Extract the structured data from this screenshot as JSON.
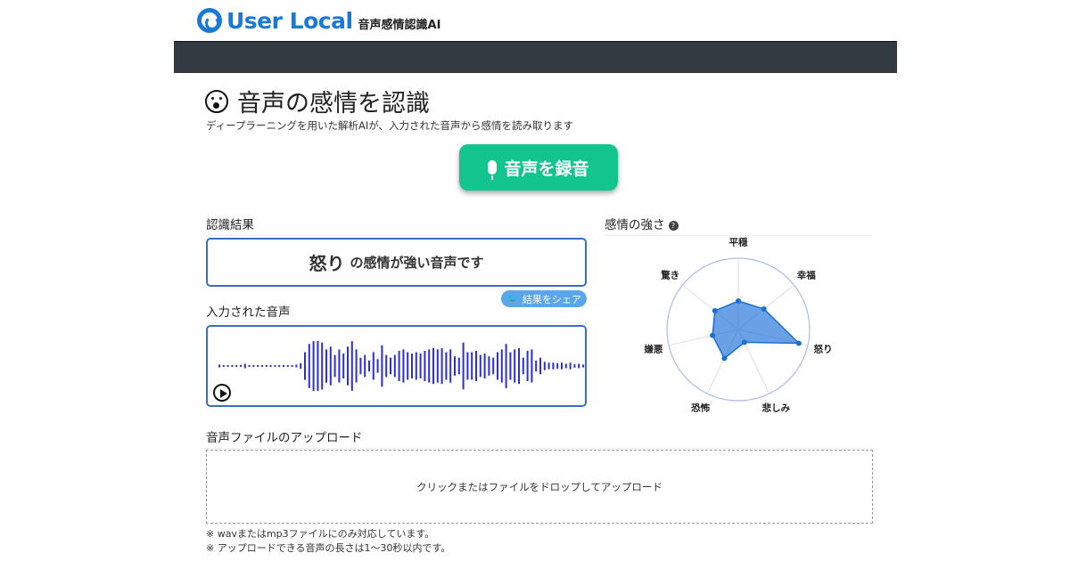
{
  "header": {
    "logo": "User Local",
    "product": "音声感情認識AI"
  },
  "page": {
    "title": "音声の感情を認識",
    "subtitle": "ディープラーニングを用いた解析AIが、入力された音声から感情を読み取ります",
    "record_button": "音声を録音"
  },
  "result": {
    "heading": "認識結果",
    "emotion": "怒り",
    "suffix": "の感情が強い音声です",
    "share": "結果をシェア"
  },
  "audio": {
    "heading": "入力された音声",
    "waveform": [
      0.05,
      0,
      0,
      0,
      0,
      0,
      0.08,
      0,
      0,
      0,
      0,
      0,
      0,
      0,
      0,
      0,
      0,
      0.03,
      0.05,
      0.1,
      0.5,
      0.8,
      0.9,
      0.9,
      0.85,
      0.6,
      0.7,
      0.4,
      0.6,
      0.45,
      0.7,
      0.9,
      0.6,
      0.3,
      0.4,
      0.2,
      0.5,
      0.25,
      0.75,
      0.4,
      0.3,
      0.4,
      0.55,
      0.6,
      0.5,
      0.45,
      0.5,
      0.45,
      0.55,
      0.6,
      0.65,
      0.6,
      0.65,
      0.5,
      0.6,
      0.35,
      0.3,
      0.85,
      0.5,
      0.5,
      0.55,
      0.4,
      0.45,
      0.35,
      0.3,
      0.5,
      0.6,
      0.8,
      0.5,
      0.6,
      0.65,
      0.3,
      0.55,
      0.6,
      0.2,
      0.3,
      0.15,
      0.12,
      0.12,
      0.1,
      0.12,
      0.08,
      0.12,
      0.06,
      0.08,
      0.05
    ]
  },
  "chart_data": {
    "type": "radar",
    "title": "感情の強さ",
    "axes": [
      "平穏",
      "幸福",
      "怒り",
      "悲しみ",
      "恐怖",
      "嫌悪",
      "驚き"
    ],
    "values": [
      0.4,
      0.46,
      0.87,
      0.2,
      0.45,
      0.37,
      0.42
    ],
    "range": [
      0,
      1
    ],
    "color": "#1a6fd6"
  },
  "upload": {
    "heading": "音声ファイルのアップロード",
    "drop_text": "クリックまたはファイルをドロップしてアップロード",
    "notes": [
      "※ wavまたはmp3ファイルにのみ対応しています。",
      "※ アップロードできる音声の長さは1〜30秒以内です。"
    ]
  }
}
